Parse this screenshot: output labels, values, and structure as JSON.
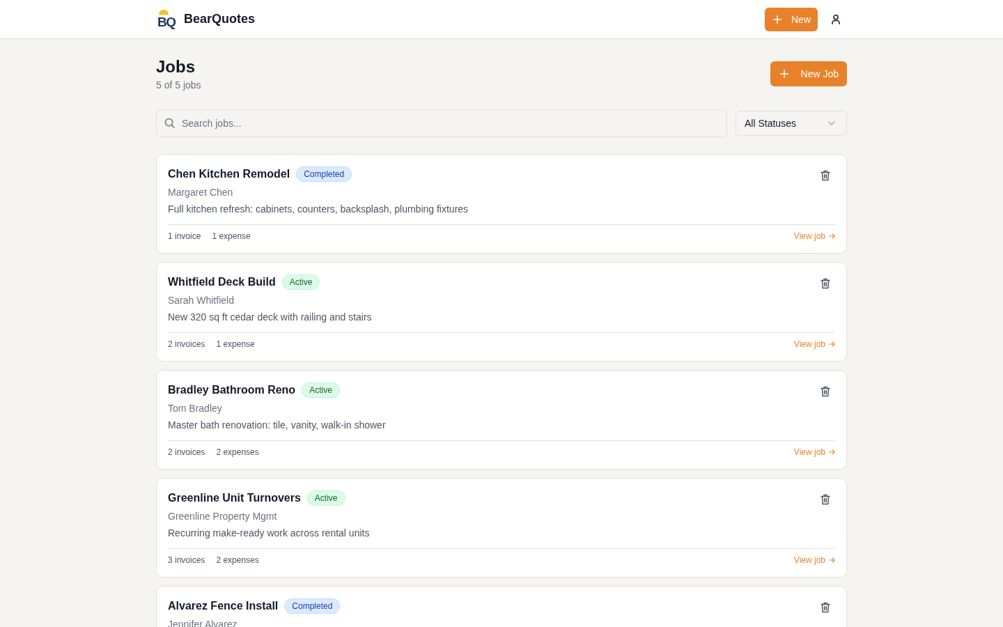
{
  "header": {
    "logo_mark": "BQ",
    "brand": "BearQuotes",
    "new_button": "New"
  },
  "page": {
    "title": "Jobs",
    "count": "5 of 5 jobs",
    "new_job_button": "New Job"
  },
  "filters": {
    "search": {
      "placeholder": "Search jobs..."
    },
    "status_select": "All Statuses"
  },
  "jobs": [
    {
      "name": "Chen Kitchen Remodel",
      "kind": "completed",
      "badge": "Completed",
      "client": "Margaret Chen",
      "description": "Full kitchen refresh: cabinets, counters, backsplash, plumbing fixtures",
      "invoices": "1 invoice",
      "expenses": "1 expense",
      "link": "View job"
    },
    {
      "name": "Whitfield Deck Build",
      "kind": "active",
      "badge": "Active",
      "client": "Sarah Whitfield",
      "description": "New 320 sq ft cedar deck with railing and stairs",
      "invoices": "2 invoices",
      "expenses": "1 expense",
      "link": "View job"
    },
    {
      "name": "Bradley Bathroom Reno",
      "kind": "active",
      "badge": "Active",
      "client": "Tom Bradley",
      "description": "Master bath renovation: tile, vanity, walk-in shower",
      "invoices": "2 invoices",
      "expenses": "2 expenses",
      "link": "View job"
    },
    {
      "name": "Greenline Unit Turnovers",
      "kind": "active",
      "badge": "Active",
      "client": "Greenline Property Mgmt",
      "description": "Recurring make-ready work across rental units",
      "invoices": "3 invoices",
      "expenses": "2 expenses",
      "link": "View job"
    },
    {
      "name": "Alvarez Fence Install",
      "kind": "completed",
      "badge": "Completed",
      "client": "Jennifer Alvarez"
    }
  ]
}
